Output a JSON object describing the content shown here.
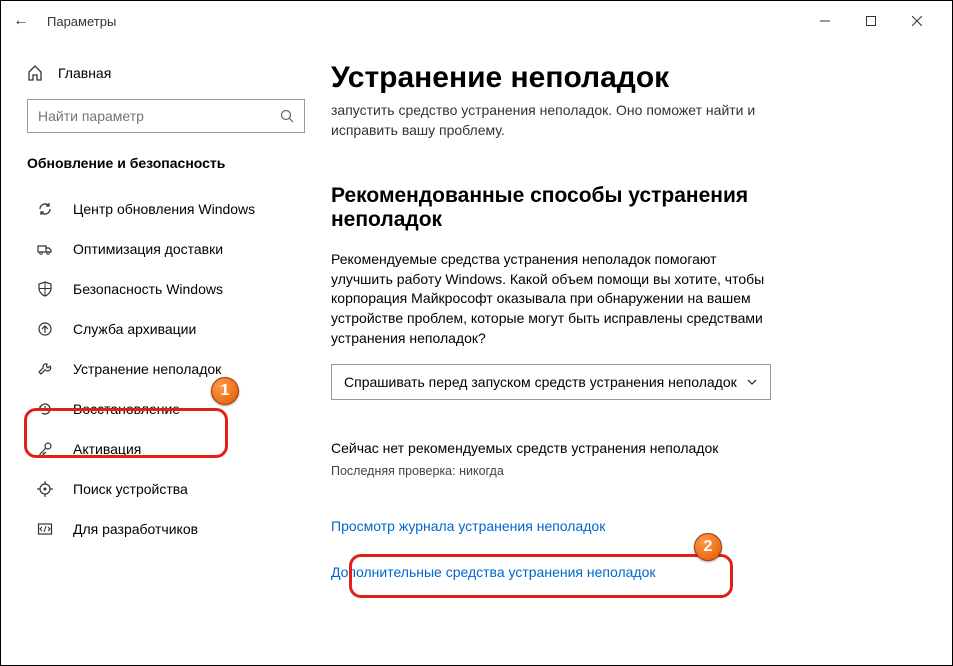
{
  "titlebar": {
    "back": "←",
    "title": "Параметры"
  },
  "sidebar": {
    "home_label": "Главная",
    "search_placeholder": "Найти параметр",
    "section_label": "Обновление и безопасность",
    "items": [
      {
        "icon": "sync",
        "label": "Центр обновления Windows"
      },
      {
        "icon": "truck",
        "label": "Оптимизация доставки"
      },
      {
        "icon": "shield",
        "label": "Безопасность Windows"
      },
      {
        "icon": "archive",
        "label": "Служба архивации"
      },
      {
        "icon": "wrench",
        "label": "Устранение неполадок"
      },
      {
        "icon": "restore",
        "label": "Восстановление"
      },
      {
        "icon": "key",
        "label": "Активация"
      },
      {
        "icon": "locate",
        "label": "Поиск устройства"
      },
      {
        "icon": "dev",
        "label": "Для разработчиков"
      }
    ]
  },
  "main": {
    "title": "Устранение неполадок",
    "intro": "запустить средство устранения неполадок. Оно поможет найти и исправить вашу проблему.",
    "sub_heading": "Рекомендованные способы устранения неполадок",
    "body": "Рекомендуемые средства устранения неполадок помогают улучшить работу Windows. Какой объем помощи вы хотите, чтобы корпорация Майкрософт оказывала при обнаружении на вашем устройстве проблем, которые могут быть исправлены средствами устранения неполадок?",
    "dropdown_value": "Спрашивать перед запуском средств устранения неполадок",
    "status": "Сейчас нет рекомендуемых средств устранения неполадок",
    "last_check": "Последняя проверка: никогда",
    "link_history": "Просмотр журнала устранения неполадок",
    "link_additional": "Дополнительные средства устранения неполадок"
  },
  "annotations": {
    "badge1": "1",
    "badge2": "2"
  }
}
